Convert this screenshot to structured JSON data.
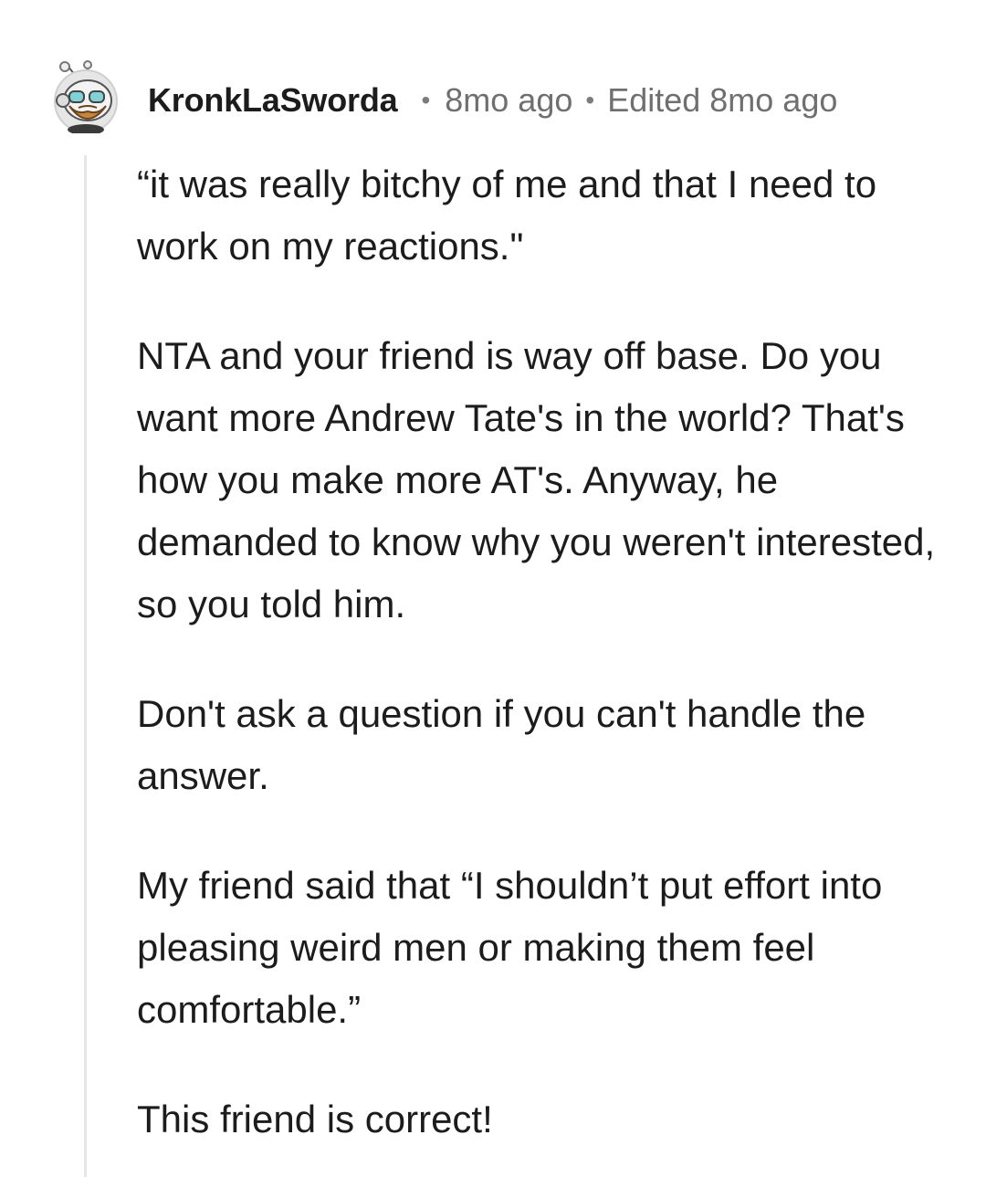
{
  "comment": {
    "avatar_icon": "snoo-avatar-icon",
    "username": "KronkLaSworda",
    "separator": "•",
    "time_ago": "8mo ago",
    "edited": "Edited 8mo ago",
    "paragraphs": [
      "“it was really bitchy of me and that I need to work on my reactions.\"",
      "NTA and your friend is way off base. Do you want more Andrew Tate's in the world? That's how you make more AT's. Anyway, he demanded to know why you weren't interested, so you told him.",
      "Don't ask a question if you can't handle the answer.",
      "My friend said that “I shouldn’t put effort into pleasing weird men or making them feel comfortable.”",
      "This friend is correct!"
    ]
  },
  "colors": {
    "text": "#1c1c1c",
    "meta": "#6f6f6f",
    "thread_line": "#e6e6e6"
  }
}
